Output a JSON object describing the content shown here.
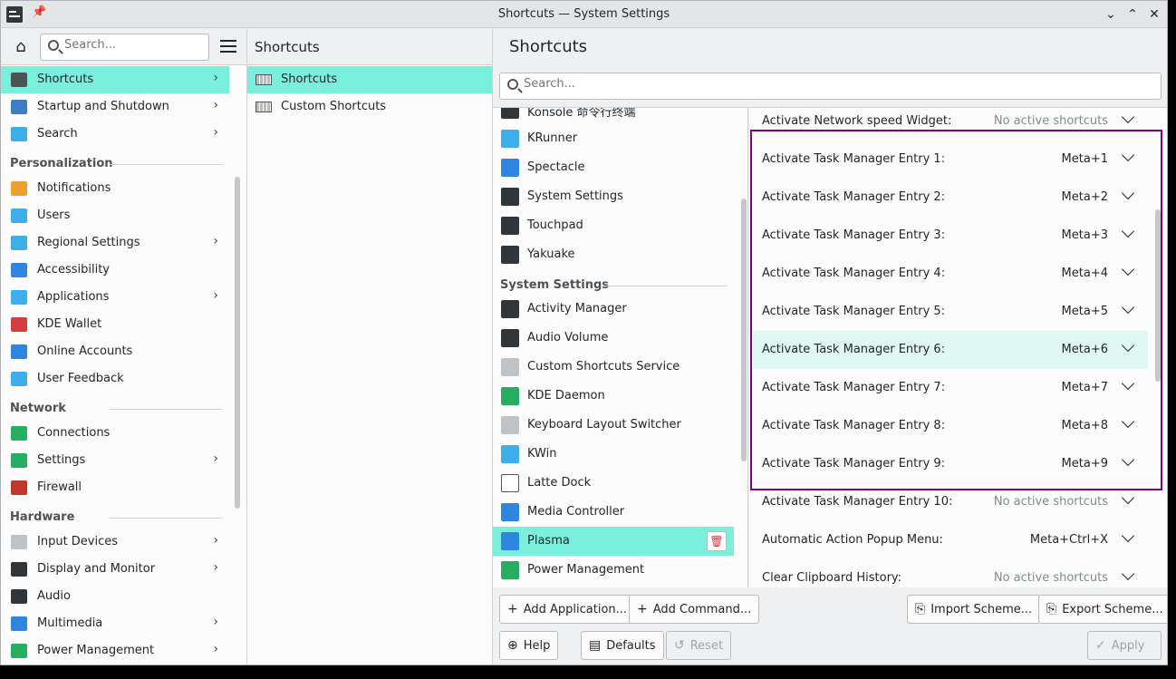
{
  "window": {
    "title": "Shortcuts — System Settings",
    "pin_glyph": "📌",
    "min_glyph": "⌄",
    "max_glyph": "⌃",
    "close_glyph": "✕"
  },
  "sidebar": {
    "search_placeholder": "Search...",
    "home_glyph": "⌂",
    "items": [
      {
        "label": "Shortcuts",
        "chevron": true,
        "selected": true,
        "color": "#4d5256"
      },
      {
        "label": "Startup and Shutdown",
        "chevron": true,
        "color": "#3d7fc4"
      },
      {
        "label": "Search",
        "chevron": true,
        "color": "#3daee9"
      }
    ],
    "sections": [
      {
        "title": "Personalization",
        "items": [
          {
            "label": "Notifications",
            "chevron": false,
            "color": "#f0a030"
          },
          {
            "label": "Users",
            "chevron": false,
            "color": "#3daee9"
          },
          {
            "label": "Regional Settings",
            "chevron": true,
            "color": "#3daee9"
          },
          {
            "label": "Accessibility",
            "chevron": false,
            "color": "#2e86de"
          },
          {
            "label": "Applications",
            "chevron": true,
            "color": "#3daee9"
          },
          {
            "label": "KDE Wallet",
            "chevron": false,
            "color": "#d04040"
          },
          {
            "label": "Online Accounts",
            "chevron": false,
            "color": "#2e86de"
          },
          {
            "label": "User Feedback",
            "chevron": false,
            "color": "#3daee9"
          }
        ]
      },
      {
        "title": "Network",
        "items": [
          {
            "label": "Connections",
            "chevron": false,
            "color": "#27ae60"
          },
          {
            "label": "Settings",
            "chevron": true,
            "color": "#27ae60"
          },
          {
            "label": "Firewall",
            "chevron": false,
            "color": "#c0392b"
          }
        ]
      },
      {
        "title": "Hardware",
        "items": [
          {
            "label": "Input Devices",
            "chevron": true,
            "color": "#bdc3c7"
          },
          {
            "label": "Display and Monitor",
            "chevron": true,
            "color": "#31363b"
          },
          {
            "label": "Audio",
            "chevron": false,
            "color": "#31363b"
          },
          {
            "label": "Multimedia",
            "chevron": true,
            "color": "#2e86de"
          },
          {
            "label": "Power Management",
            "chevron": true,
            "color": "#27ae60"
          }
        ]
      }
    ]
  },
  "column2": {
    "title": "Shortcuts",
    "items": [
      {
        "label": "Shortcuts",
        "selected": true
      },
      {
        "label": "Custom Shortcuts",
        "selected": false
      }
    ]
  },
  "main": {
    "title": "Shortcuts",
    "search_placeholder": "Search...",
    "apps": [
      {
        "type": "item",
        "label": "Konsole 命令行终端",
        "color": "#31363b"
      },
      {
        "type": "item",
        "label": "KRunner",
        "color": "#3daee9"
      },
      {
        "type": "item",
        "label": "Spectacle",
        "color": "#2e86de"
      },
      {
        "type": "item",
        "label": "System Settings",
        "color": "#31363b"
      },
      {
        "type": "item",
        "label": "Touchpad",
        "color": "#31363b"
      },
      {
        "type": "item",
        "label": "Yakuake",
        "color": "#31363b"
      },
      {
        "type": "section",
        "label": "System Settings"
      },
      {
        "type": "item",
        "label": "Activity Manager",
        "color": "#31363b"
      },
      {
        "type": "item",
        "label": "Audio Volume",
        "color": "#31363b"
      },
      {
        "type": "item",
        "label": "Custom Shortcuts Service",
        "color": "#bdc3c7"
      },
      {
        "type": "item",
        "label": "KDE Daemon",
        "color": "#27ae60"
      },
      {
        "type": "item",
        "label": "Keyboard Layout Switcher",
        "color": "#bdc3c7"
      },
      {
        "type": "item",
        "label": "KWin",
        "color": "#3daee9"
      },
      {
        "type": "item",
        "label": "Latte Dock",
        "color": "#ffffff"
      },
      {
        "type": "item",
        "label": "Media Controller",
        "color": "#2e86de"
      },
      {
        "type": "item",
        "label": "Plasma",
        "color": "#2e86de",
        "selected": true
      },
      {
        "type": "item",
        "label": "Power Management",
        "color": "#27ae60"
      }
    ],
    "shortcuts": [
      {
        "label": "Activate Network speed Widget:",
        "key": "No active shortcuts",
        "none": true
      },
      {
        "label": "Activate Task Manager Entry 1:",
        "key": "Meta+1"
      },
      {
        "label": "Activate Task Manager Entry 2:",
        "key": "Meta+2"
      },
      {
        "label": "Activate Task Manager Entry 3:",
        "key": "Meta+3"
      },
      {
        "label": "Activate Task Manager Entry 4:",
        "key": "Meta+4"
      },
      {
        "label": "Activate Task Manager Entry 5:",
        "key": "Meta+5"
      },
      {
        "label": "Activate Task Manager Entry 6:",
        "key": "Meta+6",
        "hover": true
      },
      {
        "label": "Activate Task Manager Entry 7:",
        "key": "Meta+7"
      },
      {
        "label": "Activate Task Manager Entry 8:",
        "key": "Meta+8"
      },
      {
        "label": "Activate Task Manager Entry 9:",
        "key": "Meta+9"
      },
      {
        "label": "Activate Task Manager Entry 10:",
        "key": "No active shortcuts",
        "none": true
      },
      {
        "label": "Automatic Action Popup Menu:",
        "key": "Meta+Ctrl+X"
      },
      {
        "label": "Clear Clipboard History:",
        "key": "No active shortcuts",
        "none": true
      }
    ],
    "buttons": {
      "add_application": "Add Application...",
      "add_command": "Add Command...",
      "import_scheme": "Import Scheme...",
      "export_scheme": "Export Scheme...",
      "help": "Help",
      "defaults": "Defaults",
      "reset": "Reset",
      "apply": "Apply"
    }
  },
  "colors": {
    "accent": "#7aefdc",
    "highlight_box": "#800080"
  }
}
